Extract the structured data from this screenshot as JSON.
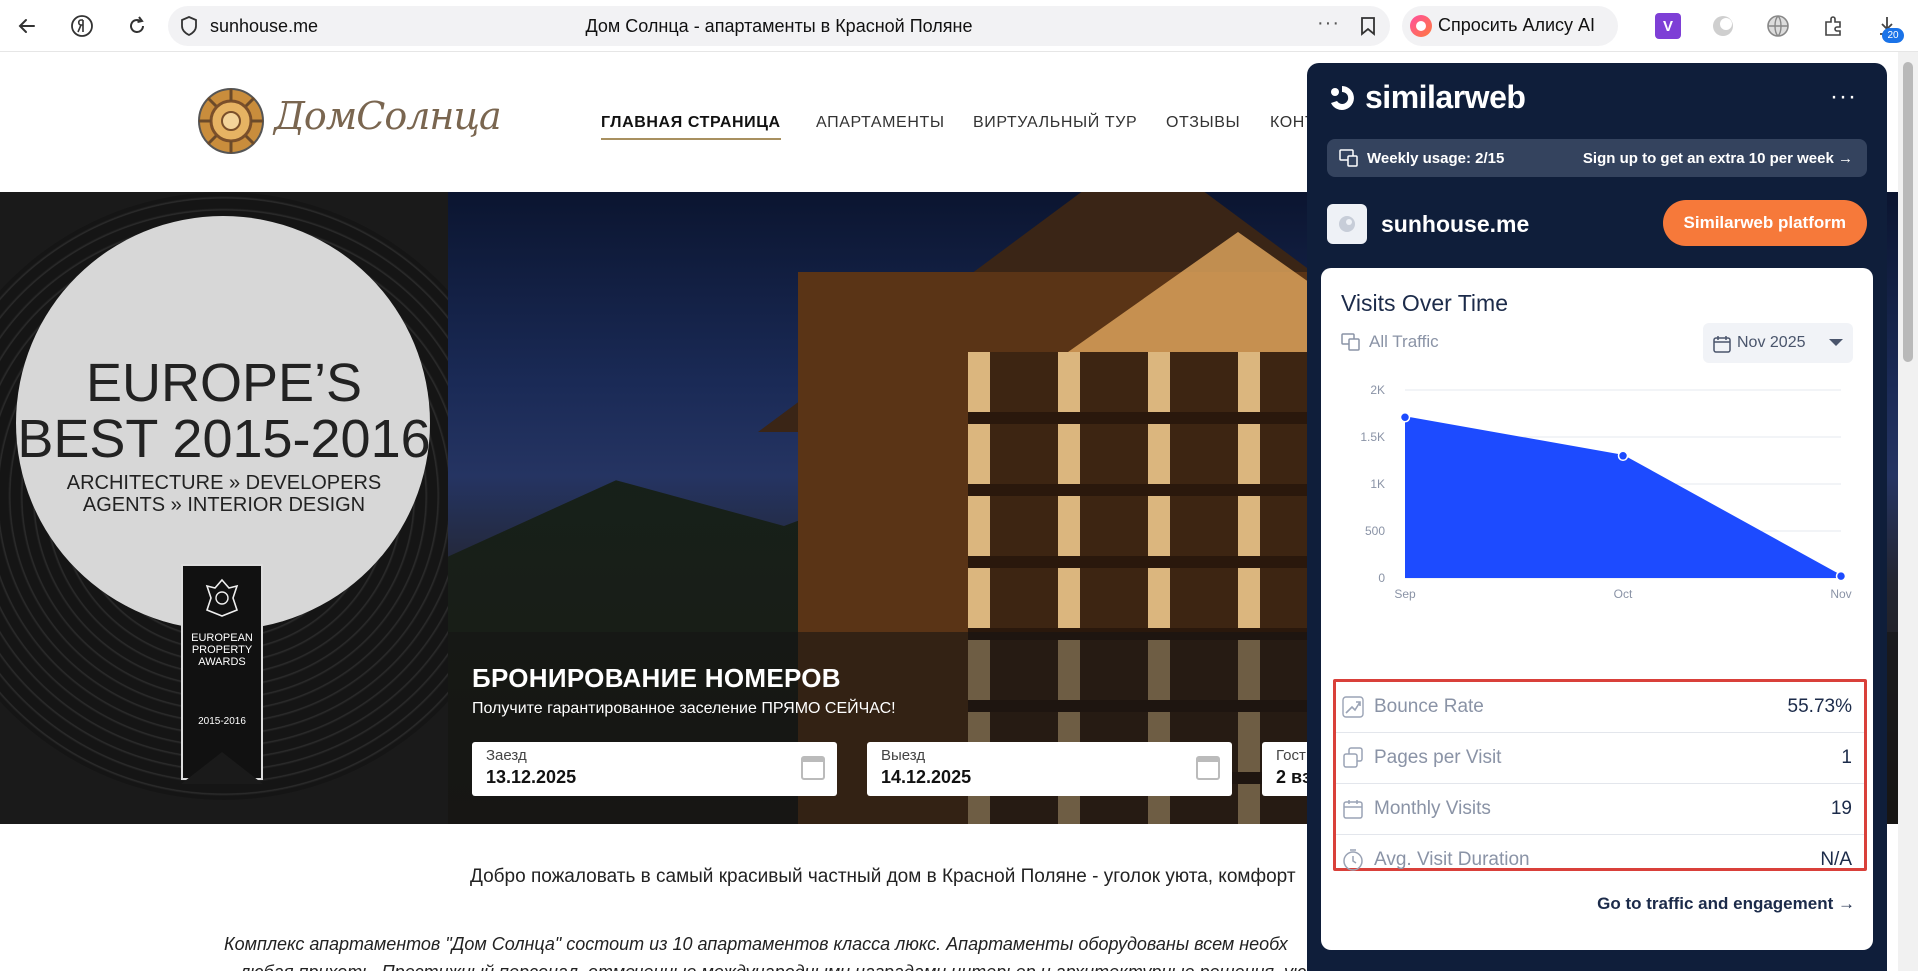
{
  "browser": {
    "url": "sunhouse.me",
    "page_title": "Дом Солнца - апартаменты в Красной Поляне",
    "alice_label": "Спросить Алису AI",
    "downloads_badge": "20",
    "extension_v": "V"
  },
  "site": {
    "logo_text": "ДомСолнца",
    "nav": [
      "ГЛАВНАЯ СТРАНИЦА",
      "АПАРТАМЕНТЫ",
      "ВИРТУАЛЬНЫЙ ТУР",
      "ОТЗЫВЫ",
      "КОНТ"
    ],
    "award": {
      "line1": "EUROPE’S",
      "line2": "BEST 2015-2016",
      "line3": "ARCHITECTURE » DEVELOPERS",
      "line4": "AGENTS » INTERIOR DESIGN",
      "ribbon": "EUROPEAN PROPERTY AWARDS",
      "ribbon_year": "2015-2016"
    },
    "booking": {
      "title": "БРОНИРОВАНИЕ НОМЕРОВ",
      "subtitle": "Получите гарантированное заселение ПРЯМО СЕЙЧАС!",
      "checkin_label": "Заезд",
      "checkin_value": "13.12.2025",
      "checkout_label": "Выезд",
      "checkout_value": "14.12.2025",
      "guests_label": "Гост",
      "guests_value": "2 вз"
    },
    "welcome": "Добро пожаловать в самый красивый частный дом в Красной Поляне - уголок уюта, комфорт",
    "complex_line1": "Комплекс апартаментов \"Дом Солнца\" состоит из 10 апартаментов класса люкс. Апартаменты оборудованы всем необх",
    "complex_line2": "любая прихоть. Престижный персонал, отмеченные международными наградами интерьер и архитектурные решения, уютный ресторан, конференц-зал и"
  },
  "similarweb": {
    "brand": "similarweb",
    "usage_label": "Weekly usage: 2/15",
    "usage_cta": "Sign up to get an extra 10 per week",
    "domain": "sunhouse.me",
    "platform_button": "Similarweb platform",
    "section_title": "Visits Over Time",
    "traffic_filter": "All Traffic",
    "month_selected": "Nov 2025",
    "metrics": [
      {
        "label": "Bounce Rate",
        "value": "55.73%",
        "icon": "trend-icon"
      },
      {
        "label": "Pages per Visit",
        "value": "1",
        "icon": "pages-icon"
      },
      {
        "label": "Monthly Visits",
        "value": "19",
        "icon": "calendar-icon"
      },
      {
        "label": "Avg. Visit Duration",
        "value": "N/A",
        "icon": "clock-icon"
      }
    ],
    "cta_link": "Go to traffic and engagement",
    "accent_color": "#1d4bff",
    "button_color": "#f6793a",
    "highlight_color": "#d9403a"
  },
  "chart_data": {
    "type": "area",
    "x": [
      "Sep",
      "Oct",
      "Nov"
    ],
    "series": [
      {
        "values": [
          1710,
          1300,
          20
        ]
      }
    ],
    "ylim": [
      0,
      2000
    ],
    "yticks": [
      "0",
      "500",
      "1K",
      "1.5K",
      "2K"
    ],
    "grid": true
  }
}
